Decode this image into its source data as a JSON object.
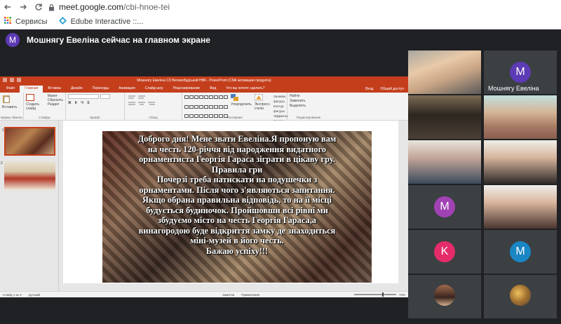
{
  "browser": {
    "url_host": "meet.google.com",
    "url_path": "/cbi-hnoe-tei",
    "bookmarks": [
      {
        "label": "Сервисы",
        "icon": "apps-grid-icon"
      },
      {
        "label": "Edube Interactive ::...",
        "icon": "edube-logo-icon"
      }
    ]
  },
  "meet": {
    "presenter_initial": "M",
    "presenter_text": "Мошнягу Евеліна сейчас на главном экране"
  },
  "powerpoint": {
    "window_title": "Мошнягу Евеліна СЗ Великобудський НВК - PowerPoint (Сбій активации продукта)",
    "tabs": [
      "Файл",
      "Главная",
      "Вставка",
      "Дизайн",
      "Переходы",
      "Анимация",
      "Слайд-шоу",
      "Рецензирование",
      "Вид",
      "Что вы хотите сделать?"
    ],
    "active_tab": "Главная",
    "tab_right": [
      "Вход",
      "Общий доступ"
    ],
    "ribbon": {
      "paste": "Вставить",
      "clipboard": "Буфер обмена",
      "new_slide": "Создать слайд",
      "layout": "Макет",
      "reset": "Сбросить",
      "section": "Раздел",
      "slides": "Слайды",
      "font": "Шрифт",
      "paragraph": "Абзац",
      "drawing": "Рисование",
      "arrange": "Упорядочить",
      "quick_styles": "Экспресс-стили",
      "shape_fill": "Заливка фигуры",
      "shape_outline": "Контур фигуры",
      "shape_effects": "Эффекты фигуры",
      "find": "Найти",
      "replace": "Заменить",
      "select": "Выделить",
      "editing": "Редактирование"
    },
    "slide_text": [
      "Доброго дня! Мене звати Евеліна.Я пропоную вам",
      "на честь 120-річчя від народження видатного",
      "орнаментиста Георгія Гараса зіграти в цікаву гру.",
      "Правила гри",
      "Почерзі треба натискати на подушечки з",
      "орнаментами. Після чого з'являються запитання.",
      "Якщо обрана правильна відповідь, то на її місці",
      "будується будиночок. Пройшовши всі рівні ми",
      "збудуємо місто на честь Георгія Гараса,а",
      "винагородою буде відкриття замку де знаходиться",
      "міні-музей в його честь.",
      "Бажаю успіху!!!"
    ],
    "thumbnails": [
      "1",
      "2"
    ],
    "status": {
      "slide_count": "Слайд 1 из 2",
      "language": "русский",
      "notes": "Заметки",
      "comments": "Примечания",
      "zoom": "73%"
    }
  },
  "participants": [
    {
      "type": "video",
      "name": ""
    },
    {
      "type": "avatar",
      "initial": "M",
      "name": "Мошнягу Евеліна",
      "color": "#5c3bb5"
    },
    {
      "type": "video",
      "name": ""
    },
    {
      "type": "video",
      "name": ""
    },
    {
      "type": "video",
      "name": ""
    },
    {
      "type": "video",
      "name": ""
    },
    {
      "type": "avatar",
      "initial": "M",
      "name": "",
      "color": "#a142b4"
    },
    {
      "type": "video",
      "name": ""
    },
    {
      "type": "avatar",
      "initial": "K",
      "name": "",
      "color": "#e52c6a"
    },
    {
      "type": "avatar",
      "initial": "M",
      "name": "",
      "color": "#1a86c4"
    },
    {
      "type": "photo",
      "name": ""
    },
    {
      "type": "photo",
      "name": ""
    }
  ]
}
